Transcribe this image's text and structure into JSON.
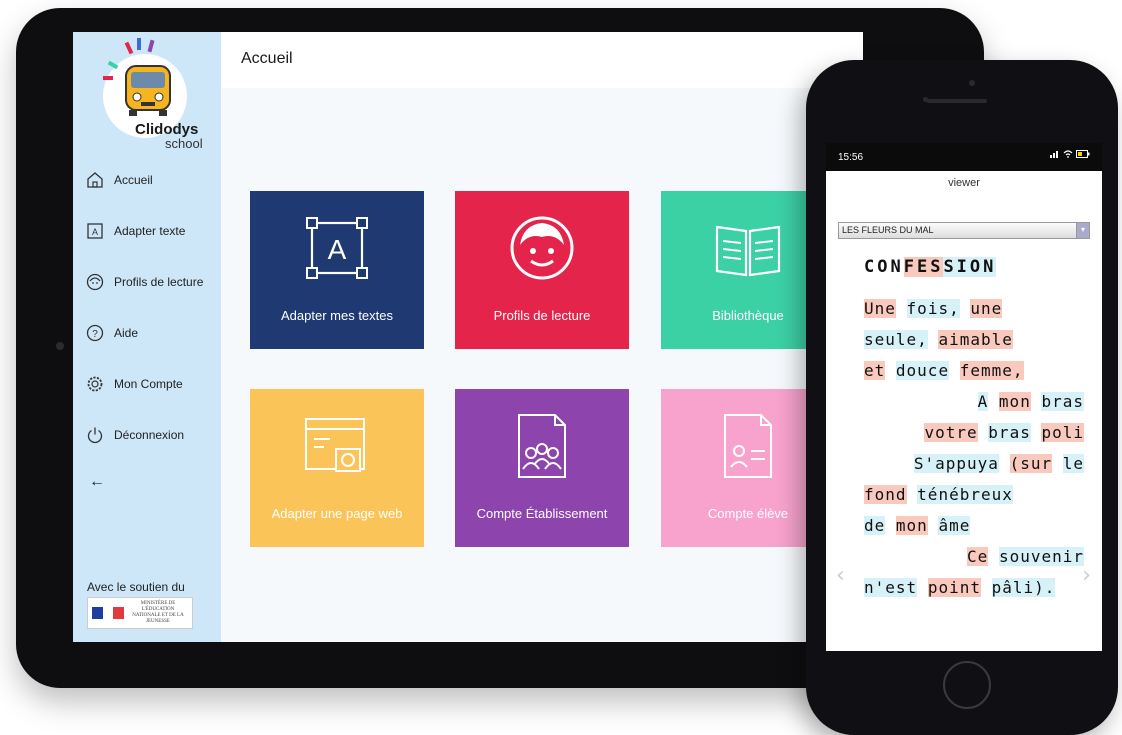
{
  "app": {
    "logo_name": "Clidodys",
    "logo_sub": "school"
  },
  "sidebar": {
    "items": [
      {
        "label": "Accueil",
        "icon": "home-icon"
      },
      {
        "label": "Adapter texte",
        "icon": "text-box-icon"
      },
      {
        "label": "Profils de lecture",
        "icon": "face-icon"
      },
      {
        "label": "Aide",
        "icon": "help-icon"
      },
      {
        "label": "Mon Compte",
        "icon": "gear-icon"
      },
      {
        "label": "Déconnexion",
        "icon": "power-icon"
      }
    ],
    "back_label": "←",
    "support_label": "Avec le soutien du",
    "ministry_text": "MINISTÈRE DE L'ÉDUCATION NATIONALE ET DE LA JEUNESSE"
  },
  "header": {
    "title": "Accueil"
  },
  "tiles": [
    {
      "label": "Adapter mes textes",
      "color": "#1f3a73",
      "icon": "text-frame-icon"
    },
    {
      "label": "Profils de lecture",
      "color": "#e4244b",
      "icon": "face-icon"
    },
    {
      "label": "Bibliothèque",
      "color": "#3cd0a5",
      "icon": "book-icon"
    },
    {
      "label": "Adapter une page web",
      "color": "#fbc458",
      "icon": "web-page-icon"
    },
    {
      "label": "Compte Établissement",
      "color": "#8e44ad",
      "icon": "group-icon"
    },
    {
      "label": "Compte élève",
      "color": "#f7a3cd",
      "icon": "student-icon"
    }
  ],
  "phone": {
    "time": "15:56",
    "viewer_title": "viewer",
    "select_value": "LES FLEURS DU MAL",
    "reading": {
      "title": "CONFESSION",
      "lines": [
        "Une fois, une",
        "seule, aimable",
        "et douce femme,",
        "A mon bras",
        "votre bras poli",
        "S'appuya (sur le",
        "fond ténébreux",
        "de mon âme",
        "Ce souvenir",
        "n'est point pâli)."
      ]
    },
    "colors": {
      "highlight_a": "#f9c9bd",
      "highlight_b": "#d6f1f7"
    }
  }
}
